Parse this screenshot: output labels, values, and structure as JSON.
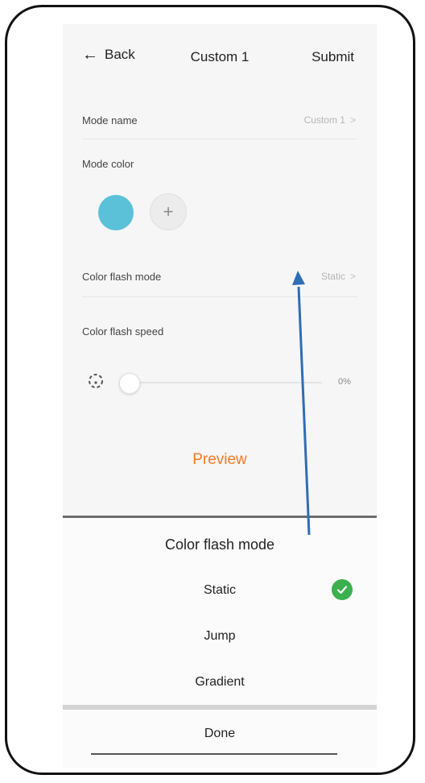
{
  "header": {
    "back_label": "Back",
    "title": "Custom 1",
    "submit_label": "Submit"
  },
  "settings": {
    "mode_name_label": "Mode name",
    "mode_name_value": "Custom 1",
    "mode_color_label": "Mode color",
    "color_swatch": "#5bc1d8",
    "add_color_symbol": "+",
    "flash_mode_label": "Color flash mode",
    "flash_mode_value": "Static",
    "flash_speed_label": "Color flash speed",
    "flash_speed_value": "0%",
    "chevron": ">"
  },
  "preview_label": "Preview",
  "sheet": {
    "title": "Color flash mode",
    "options": [
      {
        "label": "Static",
        "selected": true
      },
      {
        "label": "Jump",
        "selected": false
      },
      {
        "label": "Gradient",
        "selected": false
      }
    ],
    "done_label": "Done"
  },
  "icons": {
    "back": "left-arrow-icon",
    "check": "check-circle-icon",
    "speed": "speed-gauge-icon"
  },
  "colors": {
    "accent_orange": "#f07a25",
    "check_green": "#3ab04e",
    "annotation_blue": "#2f6db5"
  }
}
